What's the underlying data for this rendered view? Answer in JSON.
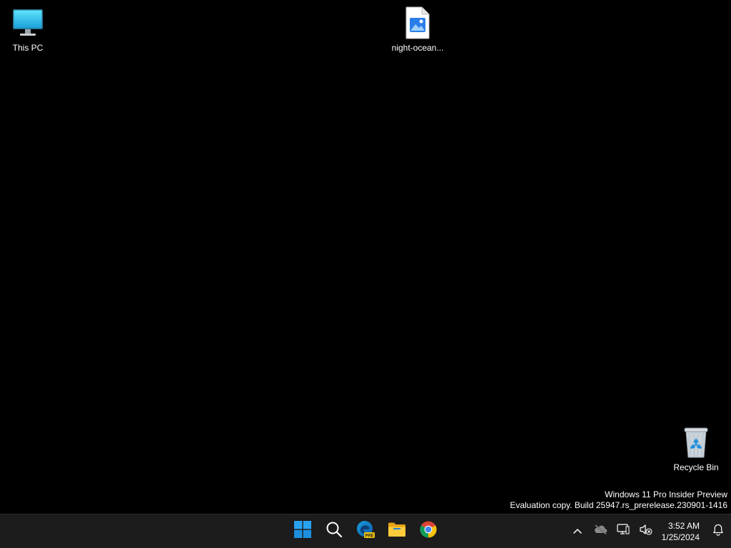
{
  "desktop": {
    "background_color": "#000000",
    "icons": [
      {
        "label": "This PC",
        "icon": "this-pc-icon"
      },
      {
        "label": "night-ocean...",
        "icon": "image-file-icon"
      },
      {
        "label": "Recycle Bin",
        "icon": "recycle-bin-icon"
      }
    ],
    "watermark": {
      "line1": "Windows 11 Pro Insider Preview",
      "line2": "Evaluation copy. Build 25947.rs_prerelease.230901-1416"
    }
  },
  "taskbar": {
    "background_color": "#1c1c1c",
    "pinned": [
      {
        "name": "Start",
        "icon": "windows-start-icon"
      },
      {
        "name": "Search",
        "icon": "search-icon"
      },
      {
        "name": "Microsoft Edge Preview",
        "icon": "edge-preview-icon",
        "badge": "PRE"
      },
      {
        "name": "File Explorer",
        "icon": "file-explorer-icon"
      },
      {
        "name": "Google Chrome",
        "icon": "chrome-icon"
      }
    ],
    "tray": {
      "icons": [
        {
          "name": "Show hidden icons",
          "icon": "chevron-up-icon"
        },
        {
          "name": "OneDrive",
          "icon": "onedrive-icon"
        },
        {
          "name": "Network",
          "icon": "network-icon"
        },
        {
          "name": "Volume muted",
          "icon": "volume-muted-icon"
        }
      ],
      "time": "3:52 AM",
      "date": "1/25/2024",
      "notifications_icon": "bell-icon"
    }
  }
}
